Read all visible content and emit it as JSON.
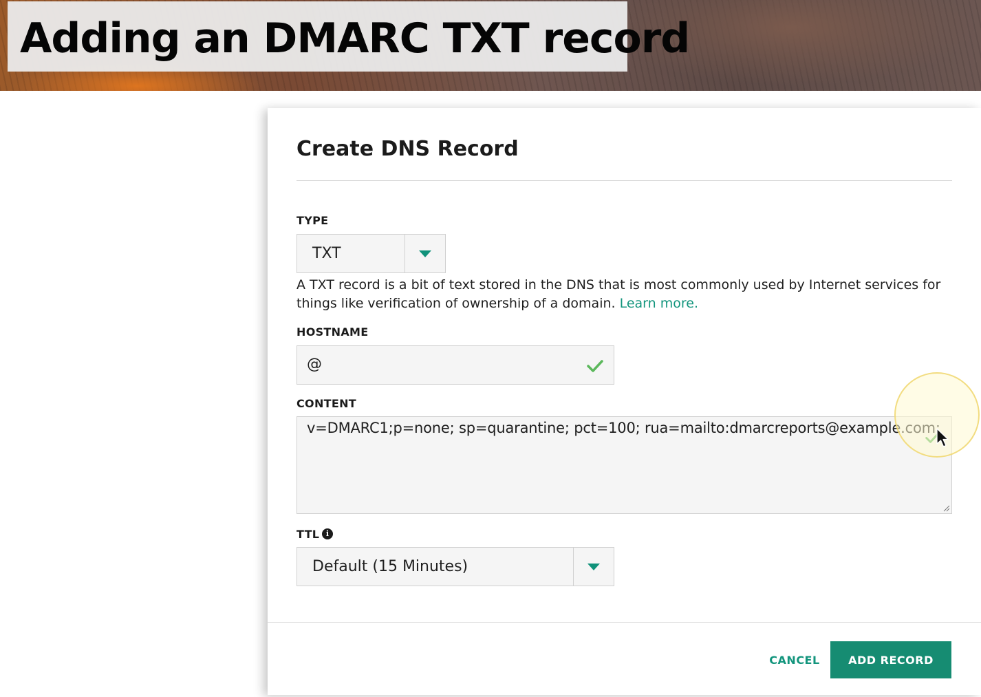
{
  "banner": {
    "title": "Adding an DMARC TXT record"
  },
  "dialog": {
    "title": "Create DNS Record",
    "type": {
      "label": "TYPE",
      "value": "TXT"
    },
    "help": {
      "text": "A TXT record is a bit of text stored in the DNS that is most commonly used by Internet services for things like verification of ownership of a domain. ",
      "link": "Learn more."
    },
    "hostname": {
      "label": "HOSTNAME",
      "value": "@"
    },
    "content": {
      "label": "CONTENT",
      "value": "v=DMARC1;p=none; sp=quarantine; pct=100; rua=mailto:dmarcreports@example.com;"
    },
    "ttl": {
      "label": "TTL",
      "value": "Default (15 Minutes)"
    },
    "buttons": {
      "cancel": "CANCEL",
      "add": "ADD RECORD"
    }
  },
  "colors": {
    "accent": "#13957d",
    "primary_button": "#168c72",
    "valid_check": "#5cb85c"
  },
  "icons": [
    "chevron-down-icon",
    "check-icon",
    "info-icon",
    "resize-handle-icon",
    "mouse-cursor-icon"
  ]
}
